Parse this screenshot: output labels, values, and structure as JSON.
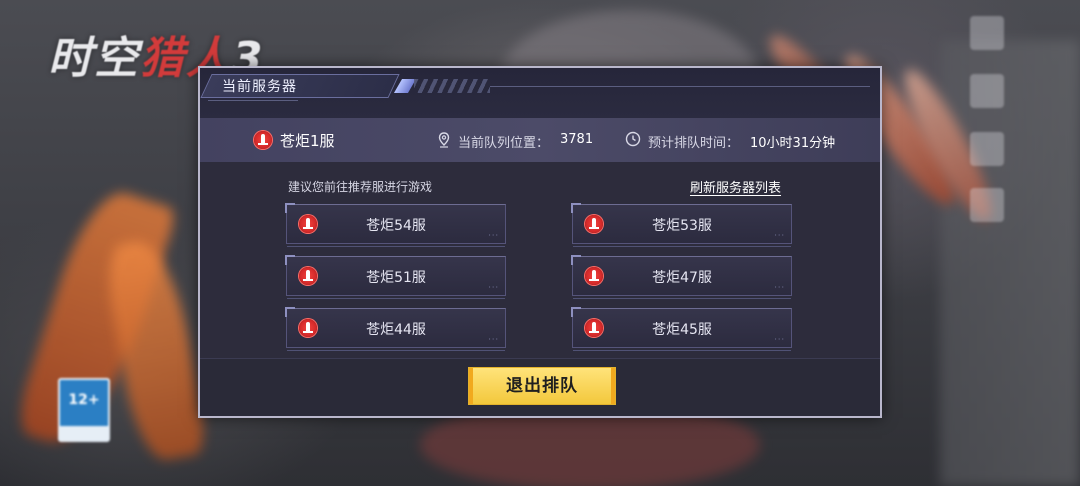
{
  "backdrop": {
    "game_logo_main": "时空",
    "game_logo_accent": "猎人",
    "game_logo_tail": "3",
    "age_rating": "12+"
  },
  "dialog": {
    "title": "当前服务器",
    "current_server": {
      "name": "苍炬1服",
      "queue_label": "当前队列位置：",
      "queue_position": "3781",
      "eta_label": "预计排队时间：",
      "eta_value": "10小时31分钟"
    },
    "recommend_text": "建议您前往推荐服进行游戏",
    "refresh_label": "刷新服务器列表",
    "servers": [
      {
        "label": "苍炬54服"
      },
      {
        "label": "苍炬53服"
      },
      {
        "label": "苍炬51服"
      },
      {
        "label": "苍炬47服"
      },
      {
        "label": "苍炬44服"
      },
      {
        "label": "苍炬45服"
      }
    ],
    "exit_label": "退出排队"
  },
  "colors": {
    "dialog_bg": "#2d2c3c",
    "info_band": "#4c4b68",
    "server_icon": "#d52a2a",
    "exit_button": "#f3c83c"
  },
  "icons": [
    "server-flame-icon",
    "location-pin-icon",
    "clock-icon"
  ]
}
